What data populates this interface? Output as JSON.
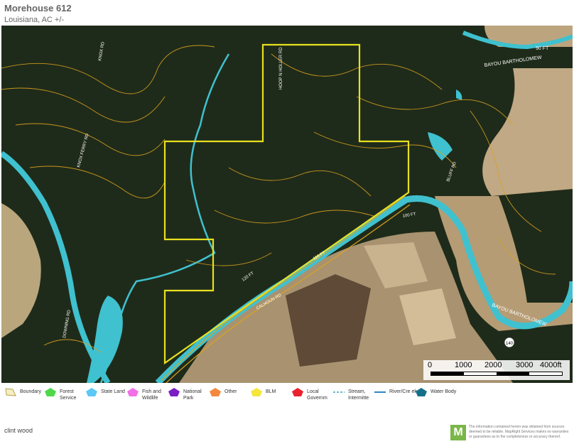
{
  "header": {
    "title": "Morehouse 612",
    "subtitle": "Louisiana,  AC +/-"
  },
  "map": {
    "road_labels": [
      "KNOX RD",
      "HOOP N HOLLER RD",
      "KNOX FERRY RD",
      "BLUFF RD",
      "BAYOU BARTHOLOMEW",
      "CALHOUN RD",
      "DOWNING RD",
      "140"
    ],
    "contour_labels": [
      "90 FT",
      "100 FT",
      "110 FT",
      "120 FT"
    ],
    "colors": {
      "boundary": "#e8e020",
      "contour": "#d9a21f",
      "water": "#3fc1cf",
      "forest": "#1f2b1a",
      "field": "#b8a27a"
    }
  },
  "scalebar": {
    "labels": [
      "0",
      "1000",
      "2000",
      "3000",
      "4000ft"
    ]
  },
  "legend": {
    "items": [
      {
        "label": "Boundary",
        "color": "#e8e3a0",
        "icon": "boundary-icon"
      },
      {
        "label": "Forest Service",
        "color": "#4ed84a",
        "icon": "forest-service-icon"
      },
      {
        "label": "State Land",
        "color": "#5bc8f5",
        "icon": "state-land-icon"
      },
      {
        "label": "Fish and Wildlife",
        "color": "#f26ee6",
        "icon": "fish-wildlife-icon"
      },
      {
        "label": "National Park",
        "color": "#7a1fc4",
        "icon": "national-park-icon"
      },
      {
        "label": "Other",
        "color": "#f5883c",
        "icon": "other-icon"
      },
      {
        "label": "BLM",
        "color": "#f5e63a",
        "icon": "blm-icon"
      },
      {
        "label": "Local Governm",
        "color": "#e8232e",
        "icon": "local-government-icon"
      },
      {
        "label": "Stream, Intermitte",
        "color": "#3aa5b8",
        "icon": "stream-intermittent-icon"
      },
      {
        "label": "River/Cre ek",
        "color": "#2b86c2",
        "icon": "river-creek-icon"
      },
      {
        "label": "Water Body",
        "color": "#16708a",
        "icon": "water-body-icon"
      }
    ]
  },
  "footer": {
    "author": "clint wood",
    "logo_letter": "M",
    "disclaimer": "The information contained herein was obtained from sources deemed to be reliable. MapRight Services makes no warranties or guarantees as to the completeness or accuracy thereof."
  }
}
